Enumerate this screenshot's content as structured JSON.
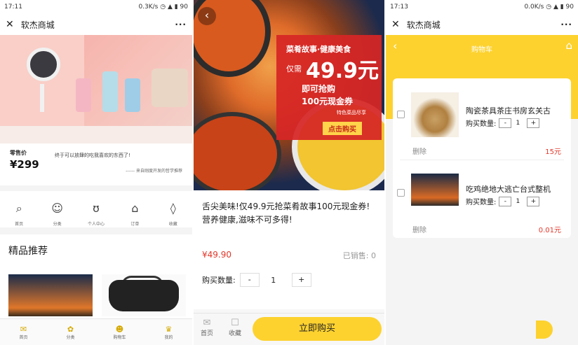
{
  "p1": {
    "status": {
      "time": "17:11",
      "net": "0.3K/s",
      "battery": "90"
    },
    "title": "软杰商城",
    "price_label": "零售价",
    "price": "¥299",
    "price_note": "终于可以放肆的吃我喜欢的东西了!",
    "price_note2": "------ 来自刚度开发的哲学推荐",
    "icons": [
      {
        "label": "首页",
        "icon": "home-icon",
        "glyph": "⌕"
      },
      {
        "label": "分类",
        "icon": "category-icon",
        "glyph": "☺"
      },
      {
        "label": "个人中心",
        "icon": "user-center-icon",
        "glyph": "ʊ"
      },
      {
        "label": "订单",
        "icon": "order-icon",
        "glyph": "⌂"
      },
      {
        "label": "收藏",
        "icon": "favorite-icon",
        "glyph": "◊"
      }
    ],
    "section_title": "精品推荐",
    "tabs": [
      {
        "label": "首页",
        "glyph": "✉"
      },
      {
        "label": "分类",
        "glyph": "✿"
      },
      {
        "label": "购物车",
        "glyph": "☻"
      },
      {
        "label": "我的",
        "glyph": "♛"
      }
    ]
  },
  "p2": {
    "promo": {
      "line1": "菜肴故事·健康美食",
      "only": "仅需",
      "big": "49.9元",
      "line3": "即可抢购",
      "line4": "100元现金券",
      "line5": "特色菜品尽享",
      "button": "点击购买"
    },
    "description": "舌尖美味!仅49.9元抢菜肴故事100元现金券!营养健康,滋味不可多得!",
    "price": "¥49.90",
    "sold": "已销售: 0",
    "qty_label": "购买数量:",
    "qty_minus": "-",
    "qty_value": "1",
    "qty_plus": "+",
    "tabs": [
      {
        "label": "首页",
        "glyph": "✉"
      },
      {
        "label": "收藏",
        "glyph": "☐"
      }
    ],
    "buy_button": "立即购买"
  },
  "p3": {
    "status": {
      "time": "17:13",
      "net": "0.0K/s",
      "battery": "90"
    },
    "title": "软杰商城",
    "header_title": "购物车",
    "items": [
      {
        "name": "陶瓷茶具茶庄书房玄关古",
        "qty_label": "购买数量:",
        "minus": "-",
        "qty": "1",
        "plus": "+",
        "delete": "删除",
        "amount": "15元"
      },
      {
        "name": "吃鸡绝地大逃亡台式整机",
        "qty_label": "购买数量:",
        "minus": "-",
        "qty": "1",
        "plus": "+",
        "delete": "删除",
        "amount": "0.01元"
      }
    ]
  },
  "colors": {
    "accent": "#fdd22f",
    "price_red": "#e2372a",
    "promo_red": "#d62626"
  }
}
